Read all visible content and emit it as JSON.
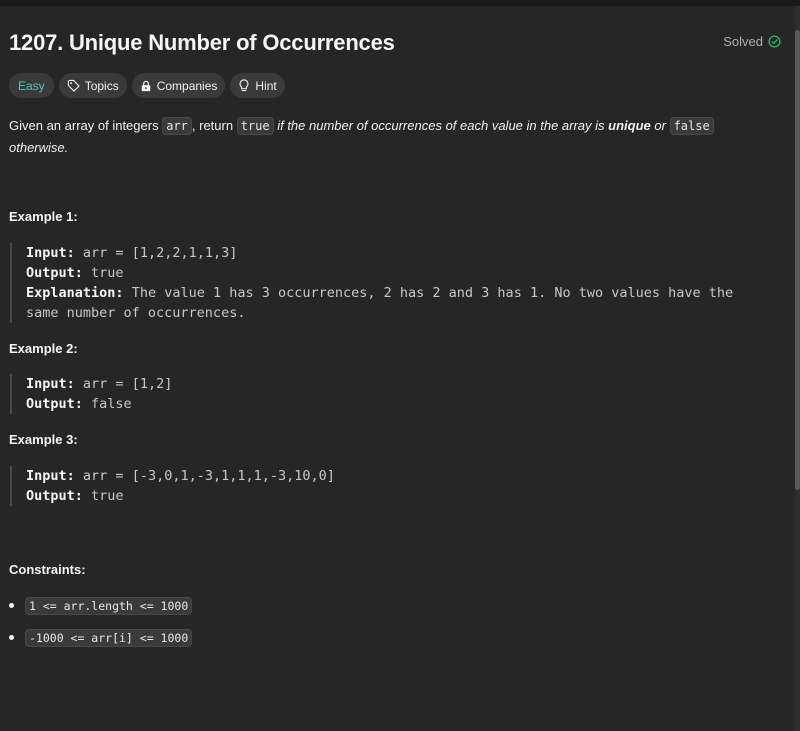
{
  "problem": {
    "title": "1207. Unique Number of Occurrences",
    "status": "Solved"
  },
  "tags": [
    {
      "label": "Easy",
      "icon": ""
    },
    {
      "label": "Topics",
      "icon": "tag-icon"
    },
    {
      "label": "Companies",
      "icon": "lock-icon"
    },
    {
      "label": "Hint",
      "icon": "lightbulb-icon"
    }
  ],
  "description": {
    "p1": "Given an array of integers ",
    "code_arr": "arr",
    "p2": ", return ",
    "code_true": "true",
    "p3": " if the number of occurrences of each value in the array is ",
    "unique": "unique",
    "p4": " or ",
    "code_false": "false",
    "p5": "otherwise."
  },
  "examples": [
    {
      "title": "Example 1:",
      "input_label": "Input:",
      "input": "arr = [1,2,2,1,1,3]",
      "output_label": "Output:",
      "output": "true",
      "explanation_label": "Explanation:",
      "explanation": "The value 1 has 3 occurrences, 2 has 2 and 3 has 1. No two values have the same number of occurrences."
    },
    {
      "title": "Example 2:",
      "input_label": "Input:",
      "input": "arr = [1,2]",
      "output_label": "Output:",
      "output": "false"
    },
    {
      "title": "Example 3:",
      "input_label": "Input:",
      "input": "arr = [-3,0,1,-3,1,1,1,-3,10,0]",
      "output_label": "Output:",
      "output": "true"
    }
  ],
  "constraints": {
    "title": "Constraints:",
    "items": [
      "1 <= arr.length <= 1000",
      "-1000 <= arr[i] <= 1000"
    ]
  },
  "colors": {
    "easy": "#46c6c2",
    "solved_check": "#2cbb5d",
    "background": "#262626"
  }
}
